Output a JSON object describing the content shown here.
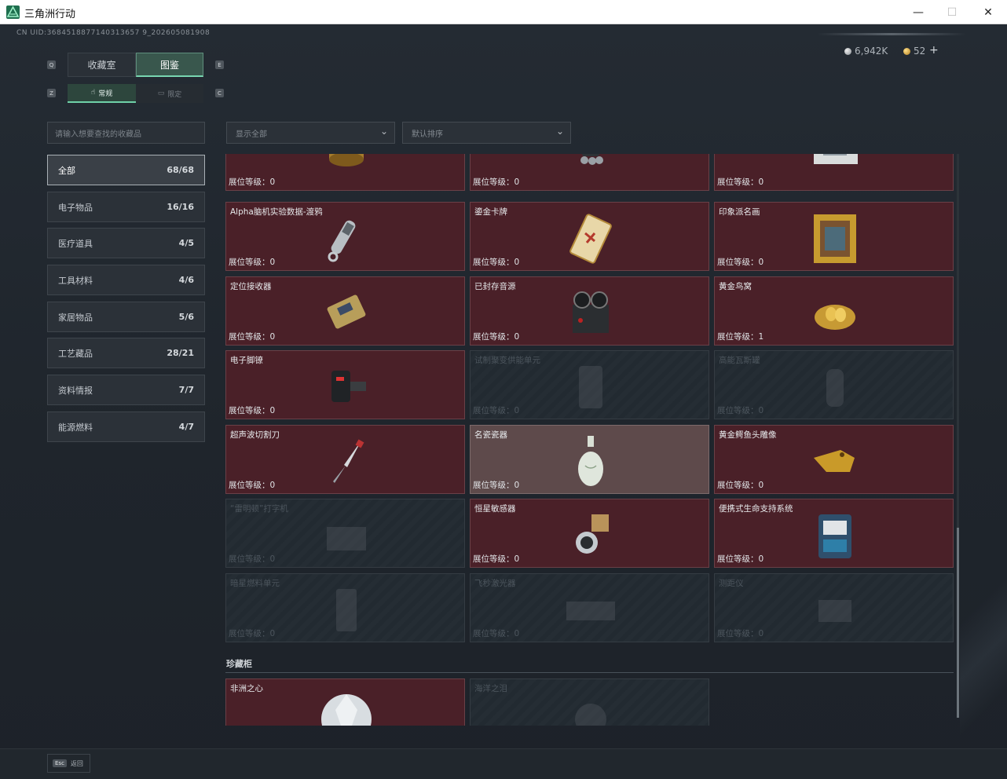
{
  "window": {
    "title": "三角洲行动",
    "min": "—",
    "max": "☐",
    "close": "✕"
  },
  "uid": "CN UID:3684518877140313657 9_202605081908",
  "currency": {
    "silver": "6,942K",
    "gold": "52",
    "plus": "+"
  },
  "tabs": [
    {
      "label": "收藏室"
    },
    {
      "label": "图鉴"
    }
  ],
  "subtabs": [
    {
      "label": "常规",
      "icon": "hand-icon"
    },
    {
      "label": "限定",
      "icon": "box-icon"
    }
  ],
  "key_hints": {
    "tab_prev": "Q",
    "tab_next": "E",
    "sub_prev": "Z",
    "sub_next": "C"
  },
  "search": {
    "placeholder": "请输入想要查找的收藏品"
  },
  "categories": [
    {
      "label": "全部",
      "count": "68/68"
    },
    {
      "label": "电子物品",
      "count": "16/16"
    },
    {
      "label": "医疗道具",
      "count": "4/5"
    },
    {
      "label": "工具材料",
      "count": "4/6"
    },
    {
      "label": "家居物品",
      "count": "5/6"
    },
    {
      "label": "工艺藏品",
      "count": "28/21"
    },
    {
      "label": "资料情报",
      "count": "7/7"
    },
    {
      "label": "能源燃料",
      "count": "4/7"
    }
  ],
  "filters": {
    "show": "显示全部",
    "sort": "默认排序"
  },
  "level_label": "展位等级：",
  "items": [
    {
      "name": "",
      "level": "0",
      "state": "owned",
      "icon": "gold-canister-icon"
    },
    {
      "name": "",
      "level": "0",
      "state": "owned",
      "icon": "robot-device-icon"
    },
    {
      "name": "",
      "level": "0",
      "state": "owned",
      "icon": "map-document-icon"
    },
    {
      "name": "Alpha脑机实验数据-渡鸦",
      "level": "0",
      "state": "owned",
      "icon": "data-drive-icon"
    },
    {
      "name": "鎏金卡牌",
      "level": "0",
      "state": "owned",
      "icon": "gilded-card-icon"
    },
    {
      "name": "印象派名画",
      "level": "0",
      "state": "owned",
      "icon": "framed-painting-icon"
    },
    {
      "name": "定位接收器",
      "level": "0",
      "state": "owned",
      "icon": "receiver-icon"
    },
    {
      "name": "已封存音源",
      "level": "0",
      "state": "owned",
      "icon": "reel-recorder-icon"
    },
    {
      "name": "黄金鸟窝",
      "level": "1",
      "state": "owned",
      "icon": "golden-nest-icon"
    },
    {
      "name": "电子脚镣",
      "level": "0",
      "state": "owned",
      "icon": "ankle-monitor-icon"
    },
    {
      "name": "试制聚变供能单元",
      "level": "0",
      "state": "locked",
      "icon": "fusion-cell-icon"
    },
    {
      "name": "高能瓦斯罐",
      "level": "0",
      "state": "locked",
      "icon": "gas-canister-icon"
    },
    {
      "name": "超声波切割刀",
      "level": "0",
      "state": "owned",
      "icon": "ultrasonic-knife-icon"
    },
    {
      "name": "名瓷瓷器",
      "level": "0",
      "state": "owned-light",
      "icon": "porcelain-vase-icon"
    },
    {
      "name": "黄金鳄鱼头雕像",
      "level": "0",
      "state": "owned",
      "icon": "gold-crocodile-icon"
    },
    {
      "name": "“雷明顿”打字机",
      "level": "0",
      "state": "locked",
      "icon": "typewriter-icon"
    },
    {
      "name": "恒星敏感器",
      "level": "0",
      "state": "owned",
      "icon": "star-sensor-icon"
    },
    {
      "name": "便携式生命支持系统",
      "level": "0",
      "state": "owned",
      "icon": "life-support-icon"
    },
    {
      "name": "暗星燃料单元",
      "level": "0",
      "state": "locked",
      "icon": "fuel-cell-icon"
    },
    {
      "name": "飞秒激光器",
      "level": "0",
      "state": "locked",
      "icon": "laser-icon"
    },
    {
      "name": "测距仪",
      "level": "0",
      "state": "locked",
      "icon": "rangefinder-icon"
    }
  ],
  "section": {
    "title": "珍藏柜"
  },
  "cabinet": [
    {
      "name": "非洲之心",
      "state": "owned",
      "icon": "diamond-icon"
    },
    {
      "name": "海洋之泪",
      "state": "locked",
      "icon": "gem-icon"
    }
  ],
  "footer": {
    "key": "Esc",
    "label": "返回"
  },
  "colors": {
    "owned_bg": "#4a2028",
    "accent": "#78d6b0",
    "locked_bg": "#222a31"
  }
}
